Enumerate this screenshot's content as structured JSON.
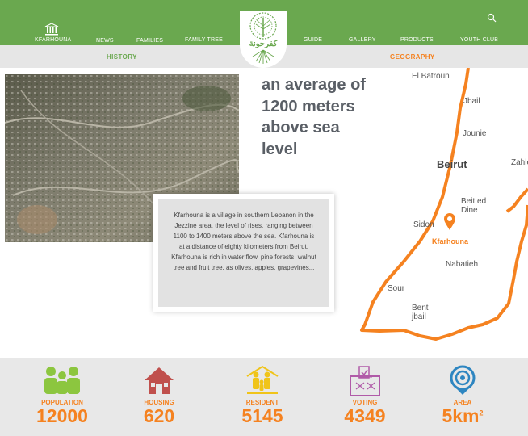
{
  "nav": {
    "home_label": "KFARHOUNA",
    "news": "NEWS",
    "families": "FAMILIES",
    "family_tree": "FAMILY TREE",
    "guide": "GUIDE",
    "gallery": "GALLERY",
    "products": "PRODUCTS",
    "youth_club": "YOUTH CLUB"
  },
  "logo": {
    "text": "كفرحونة"
  },
  "tabs": {
    "history": "HISTORY",
    "geography": "GEOGRAPHY"
  },
  "headline": "an average of 1200 meters above sea level",
  "card": {
    "text": "Kfarhouna is a village in southern Lebanon in the Jezzine area. the level of rises, ranging between 1100 to 1400 meters above the sea. Kfarhouna is at a distance of eighty kilometers from Beirut. Kfarhouna is rich in water flow, pine forests, walnut tree and fruit tree, as olives, apples, grapevines..."
  },
  "map": {
    "labels": {
      "el_batroun": "El Batroun",
      "jbail": "Jbail",
      "jounie": "Jounie",
      "beirut": "Beirut",
      "zahle": "Zahle",
      "beit_ed_dine": "Beit ed Dine",
      "sidon": "Sidon",
      "kfarhouna": "Kfarhouna",
      "nabatieh": "Nabatieh",
      "sour": "Sour",
      "bent_jbail": "Bent jbail"
    }
  },
  "stats": [
    {
      "label": "POPULATION",
      "value": "12000",
      "icon": "people-icon",
      "color": "#8cc63f"
    },
    {
      "label": "HOUSING",
      "value": "620",
      "icon": "house-icon",
      "color": "#c0504d"
    },
    {
      "label": "RESIDENT",
      "value": "5145",
      "icon": "family-icon",
      "color": "#f0c419"
    },
    {
      "label": "VOTING",
      "value": "4349",
      "icon": "ballot-box-icon",
      "color": "#b05aa8"
    },
    {
      "label": "AREA",
      "value": "5km",
      "unit_sup": "2",
      "icon": "location-target-icon",
      "color": "#2e86c1"
    }
  ],
  "colors": {
    "green": "#6aa84f",
    "orange": "#f58220",
    "gray": "#e8e8e8"
  }
}
